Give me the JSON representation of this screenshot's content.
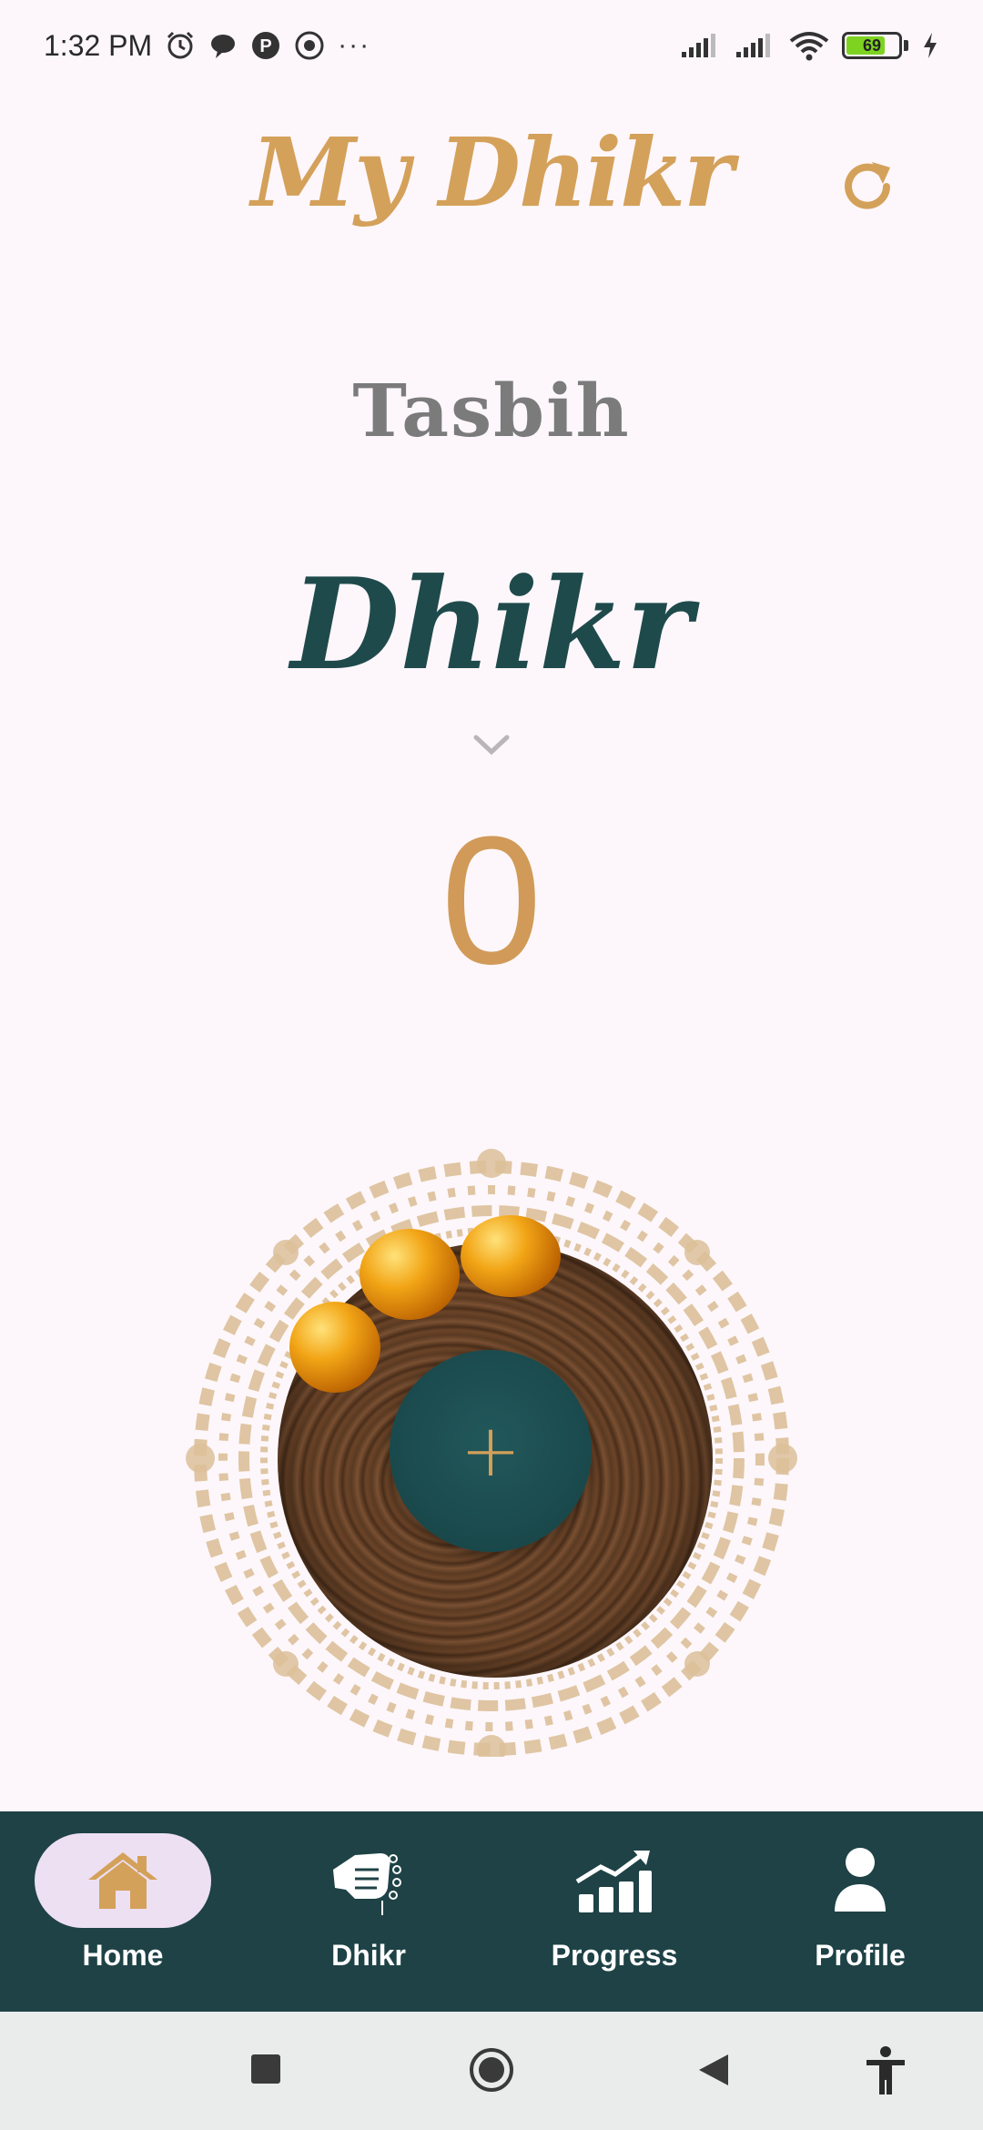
{
  "status_bar": {
    "time": "1:32 PM",
    "overflow_dots": "···",
    "battery_level": "69",
    "icons": [
      "alarm-icon",
      "chat-bubble-icon",
      "p-app-icon",
      "circle-app-icon",
      "signal-icon",
      "signal-icon",
      "wifi-icon",
      "battery-icon",
      "charging-icon"
    ]
  },
  "header": {
    "title": "My Dhikr",
    "refresh_icon": "refresh-icon"
  },
  "main": {
    "subtitle": "Tasbih",
    "dhikr_name": "Dhikr",
    "dropdown_icon": "chevron-down-icon",
    "counter": "0",
    "add_button_icon": "plus-icon",
    "add_button_label": "+"
  },
  "bottom_nav": {
    "items": [
      {
        "label": "Home",
        "icon": "home-icon",
        "active": true
      },
      {
        "label": "Dhikr",
        "icon": "tasbih-hand-icon",
        "active": false
      },
      {
        "label": "Progress",
        "icon": "progress-chart-icon",
        "active": false
      },
      {
        "label": "Profile",
        "icon": "profile-icon",
        "active": false
      }
    ]
  },
  "system_nav": {
    "items": [
      "recents-icon",
      "home-circle-icon",
      "back-icon",
      "accessibility-icon"
    ]
  },
  "colors": {
    "background": "#fdf7fb",
    "accent_gold": "#d4a15a",
    "teal_dark": "#1e4246",
    "grey_text": "#7b7b7b",
    "active_pill": "#ece0f2"
  }
}
